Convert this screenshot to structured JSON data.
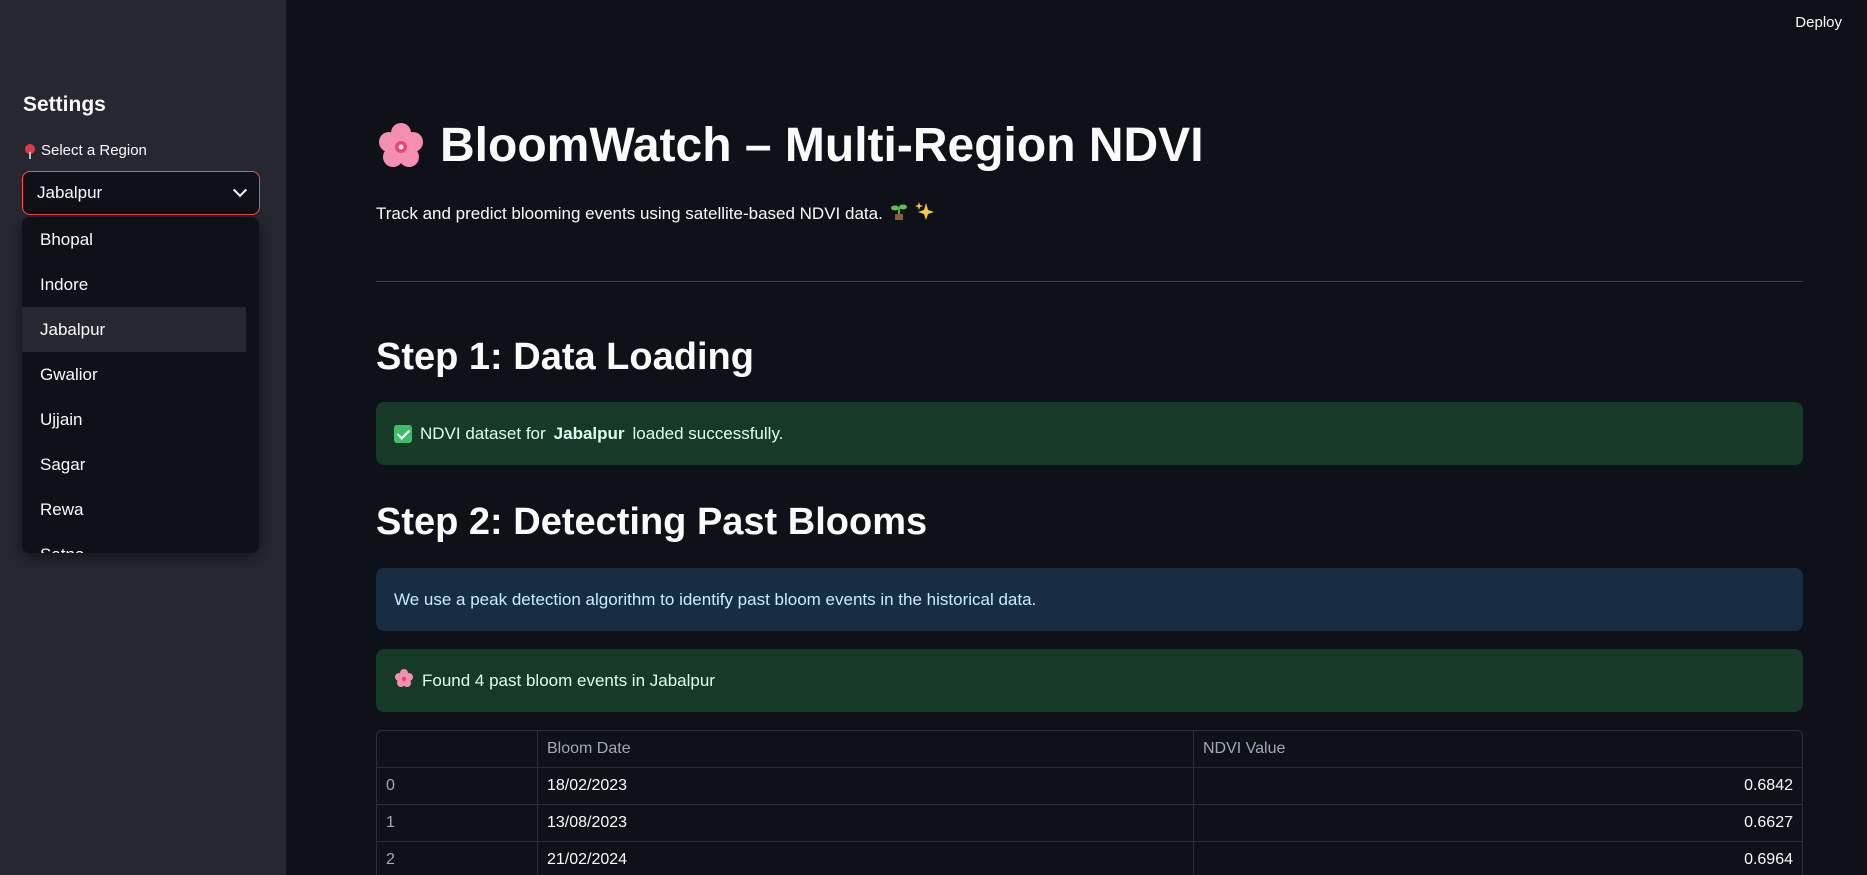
{
  "header": {
    "deploy_label": "Deploy"
  },
  "sidebar": {
    "title": "Settings",
    "region_label": "Select a Region",
    "selected_region": "Jabalpur",
    "options": [
      "Bhopal",
      "Indore",
      "Jabalpur",
      "Gwalior",
      "Ujjain",
      "Sagar",
      "Rewa",
      "Satna"
    ]
  },
  "main": {
    "title": "BloomWatch – Multi-Region NDVI",
    "subtitle": "Track and predict blooming events using satellite-based NDVI data.",
    "step1": {
      "heading": "Step 1: Data Loading",
      "alert_prefix": "NDVI dataset for",
      "alert_region": "Jabalpur",
      "alert_suffix": "loaded successfully."
    },
    "step2": {
      "heading": "Step 2: Detecting Past Blooms",
      "info": "We use a peak detection algorithm to identify past bloom events in the historical data.",
      "found": "Found 4 past bloom events in Jabalpur"
    },
    "table": {
      "columns": [
        "",
        "Bloom Date",
        "NDVI Value"
      ],
      "rows": [
        [
          "0",
          "18/02/2023",
          "0.6842"
        ],
        [
          "1",
          "13/08/2023",
          "0.6627"
        ],
        [
          "2",
          "21/02/2024",
          "0.6964"
        ]
      ]
    }
  },
  "colors": {
    "accent": "#ff4b4b",
    "success_bg": "#173928",
    "info_bg": "#172d43",
    "sidebar_bg": "#262730",
    "app_bg": "#0e1117"
  }
}
